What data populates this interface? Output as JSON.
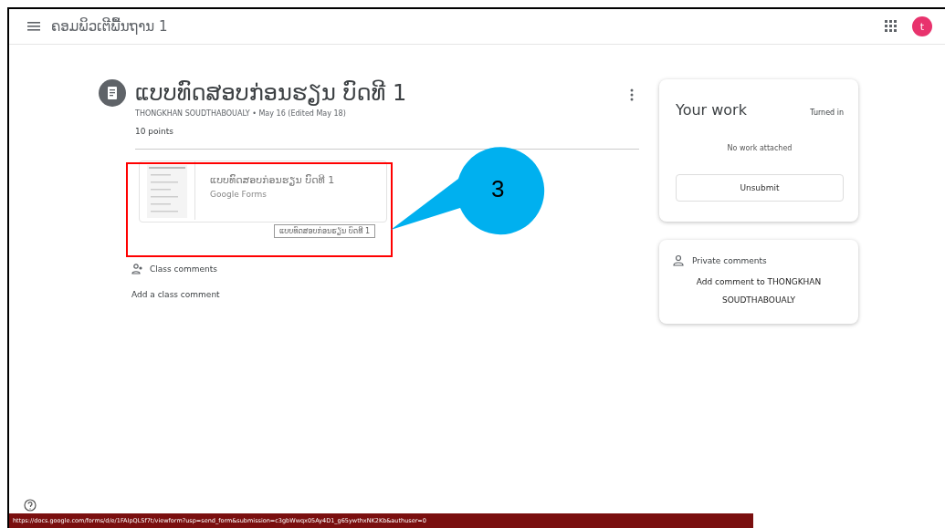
{
  "header": {
    "course_title": "ຄອມພິວເຕີພື້ນຖານ 1",
    "avatar_letter": "t"
  },
  "assignment": {
    "title": "ແບບທົດສອບກ່ອນຮຽນ ບົດທີ 1",
    "meta": "THONGKHAN SOUDTHABOUALY • May 16 (Edited May 18)",
    "points": "10 points",
    "attachment": {
      "title": "ແບບທົດສອບກ່ອນຮຽນ ບົດທີ 1",
      "type": "Google Forms",
      "tooltip": "ແບບທົດສອບກ່ອນຮຽນ ບົດທີ 1"
    },
    "class_comments": {
      "label": "Class comments",
      "add": "Add a class comment"
    }
  },
  "your_work": {
    "title": "Your work",
    "status": "Turned in",
    "empty": "No work attached",
    "button": "Unsubmit"
  },
  "private_comments": {
    "label": "Private comments",
    "add": "Add comment to THONGKHAN SOUDTHABOUALY"
  },
  "callout": {
    "label": "3"
  },
  "status_bar": {
    "url": "https://docs.google.com/forms/d/e/1FAIpQLSf7t/viewform?usp=send_form&submission=c3gbWwqx05Ay4D1_g65ywthxNK2Kb&authuser=0"
  }
}
